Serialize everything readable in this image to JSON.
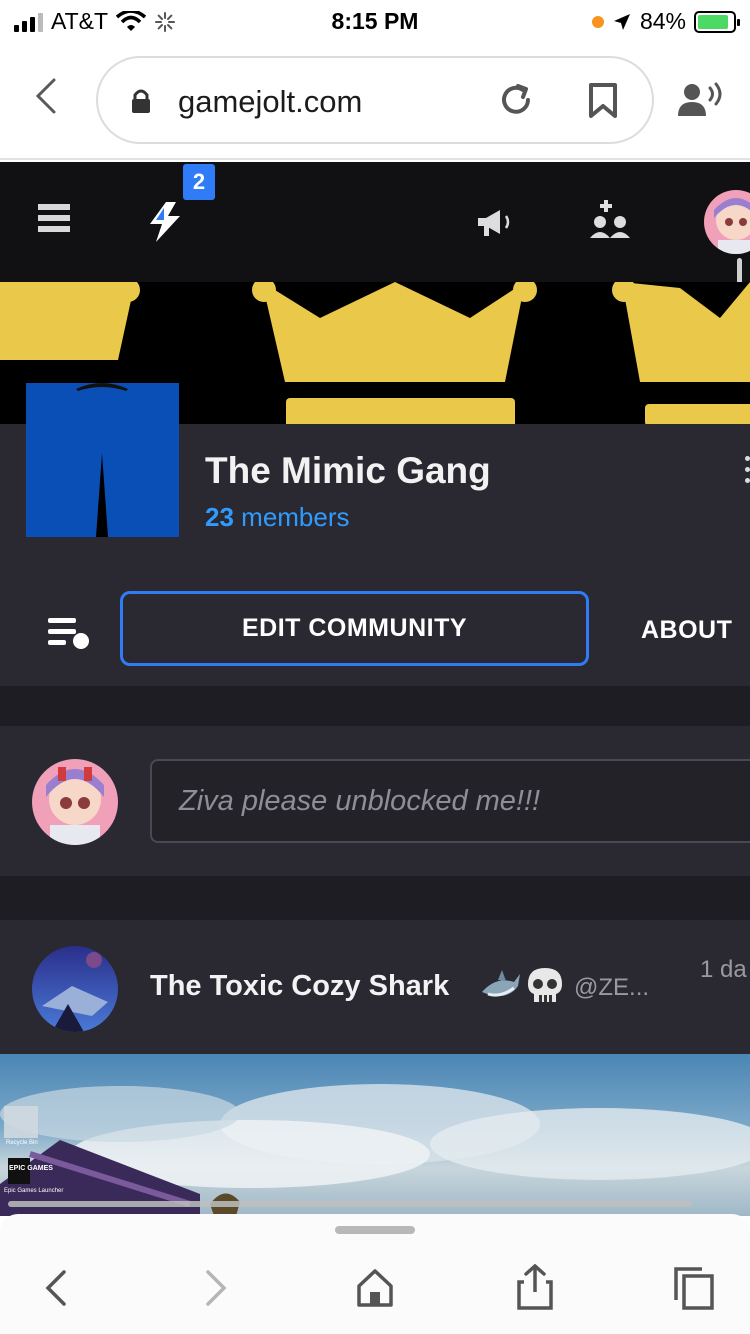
{
  "status_bar": {
    "carrier": "AT&T",
    "time": "8:15 PM",
    "battery": "84%"
  },
  "browser": {
    "url": "gamejolt.com"
  },
  "header": {
    "notification_count": "2"
  },
  "community": {
    "name": "The Mimic Gang",
    "member_count": "23",
    "member_label": "members",
    "edit_button": "EDIT COMMUNITY",
    "about_tab": "ABOUT"
  },
  "composer": {
    "placeholder": "Ziva please unblocked me!!!"
  },
  "post": {
    "author": "The Toxic Cozy Shark",
    "emojis": [
      "shark",
      "skull"
    ],
    "handle": "@ZE...",
    "time": "1 da"
  },
  "post_image_labels": {
    "desktop_icon_1": "Recycle Bin",
    "desktop_icon_2_logo": "EPIC GAMES",
    "desktop_icon_2": "Epic Games Launcher"
  },
  "colors": {
    "accent_blue": "#2f7cf6",
    "members_blue": "#2f9bff",
    "panel": "#2a2931",
    "header": "#111013",
    "crown_gold": "#e9c84a"
  }
}
